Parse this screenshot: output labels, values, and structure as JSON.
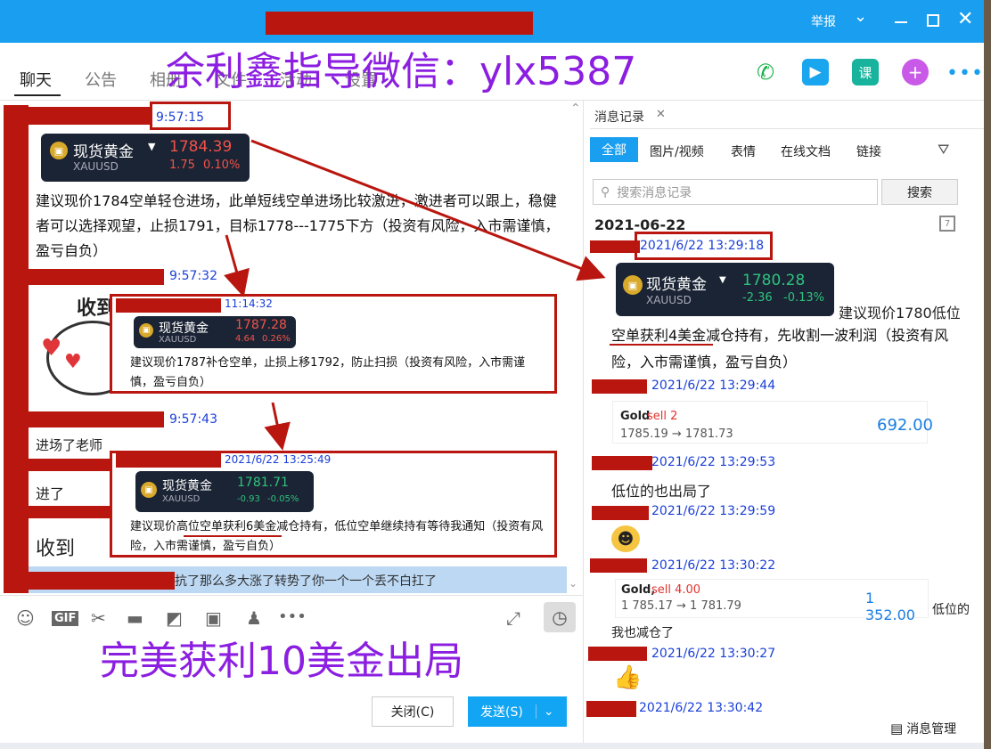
{
  "window": {
    "report": "举报",
    "watermark_top": "余利鑫指导微信：ylx5387",
    "watermark_bottom": "完美获利10美金出局"
  },
  "tabs": [
    "聊天",
    "公告",
    "相册",
    "文件",
    "活动",
    "设置"
  ],
  "chat": {
    "time1": "9:57:15",
    "card1": {
      "name": "现货黄金",
      "code": "XAUUSD",
      "price": "1784.39",
      "chg": "1.75",
      "pct": "0.10%"
    },
    "msg1": "建议现价1784空单轻仓进场，此单短线空单进场比较激进，激进者可以跟上，稳健者可以选择观望，止损1791，目标1778---1775下方（投资有风险，入市需谨慎，盈亏自负）",
    "time2": "9:57:32",
    "sticker_text": "收到",
    "inset1": {
      "time": "11:14:32",
      "name": "现货黄金",
      "code": "XAUUSD",
      "price": "1787.28",
      "chg": "4.64",
      "pct": "0.26%",
      "text": "建议现价1787补仓空单，止损上移1792，防止扫损（投资有风险，入市需谨慎，盈亏自负）"
    },
    "time3": "9:57:43",
    "msg_entered_teacher": "进场了老师",
    "msg_entered": "进了",
    "msg_received": "收到",
    "inset2": {
      "time": "2021/6/22 13:25:49",
      "name": "现货黄金",
      "code": "XAUUSD",
      "price": "1781.71",
      "chg": "-0.93",
      "pct": "-0.05%",
      "text": "建议现价高位空单获利6美金减仓持有，低位空单继续持有等待我通知（投资有风险，入市需谨慎，盈亏自负）"
    },
    "highlight": "抗了那么多大涨了转势了你一个一个丢不白扛了"
  },
  "composer": {
    "close_label": "关闭(C)",
    "send_label": "发送(S)"
  },
  "history": {
    "panel_title": "消息记录",
    "filters": [
      "全部",
      "图片/视频",
      "表情",
      "在线文档",
      "链接"
    ],
    "search_placeholder": "搜索消息记录",
    "search_button": "搜索",
    "date": "2021-06-22",
    "t1": "2021/6/22 13:29:18",
    "card": {
      "name": "现货黄金",
      "code": "XAUUSD",
      "price": "1780.28",
      "chg": "-2.36",
      "pct": "-0.13%"
    },
    "msg1_a": "建议现价1780低位",
    "msg1_b": "空单获利4美金减仓持有，先收割一波利润（投资有风险，入市需谨慎，盈亏自负）",
    "t2": "2021/6/22 13:29:44",
    "trade1": {
      "label": "Gold",
      "side": "sell 2",
      "from_to": "1785.19 → 1781.73",
      "profit": "692.00"
    },
    "t3": "2021/6/22 13:29:53",
    "msg2": "低位的也出局了",
    "t4": "2021/6/22 13:29:59",
    "t5": "2021/6/22 13:30:22",
    "trade2": {
      "label": "Gold,",
      "side": "sell 4.00",
      "from_to": "1 785.17 → 1 781.79",
      "profit": "1 352.00"
    },
    "msg3_a": "低位的",
    "msg3_b": "我也减仓了",
    "t6": "2021/6/22 13:30:27",
    "t7": "2021/6/22 13:30:42",
    "manage": "消息管理"
  },
  "colors": {
    "red": "#b8160f",
    "blue": "#1a9ff0",
    "purple": "#8b1ee0"
  }
}
